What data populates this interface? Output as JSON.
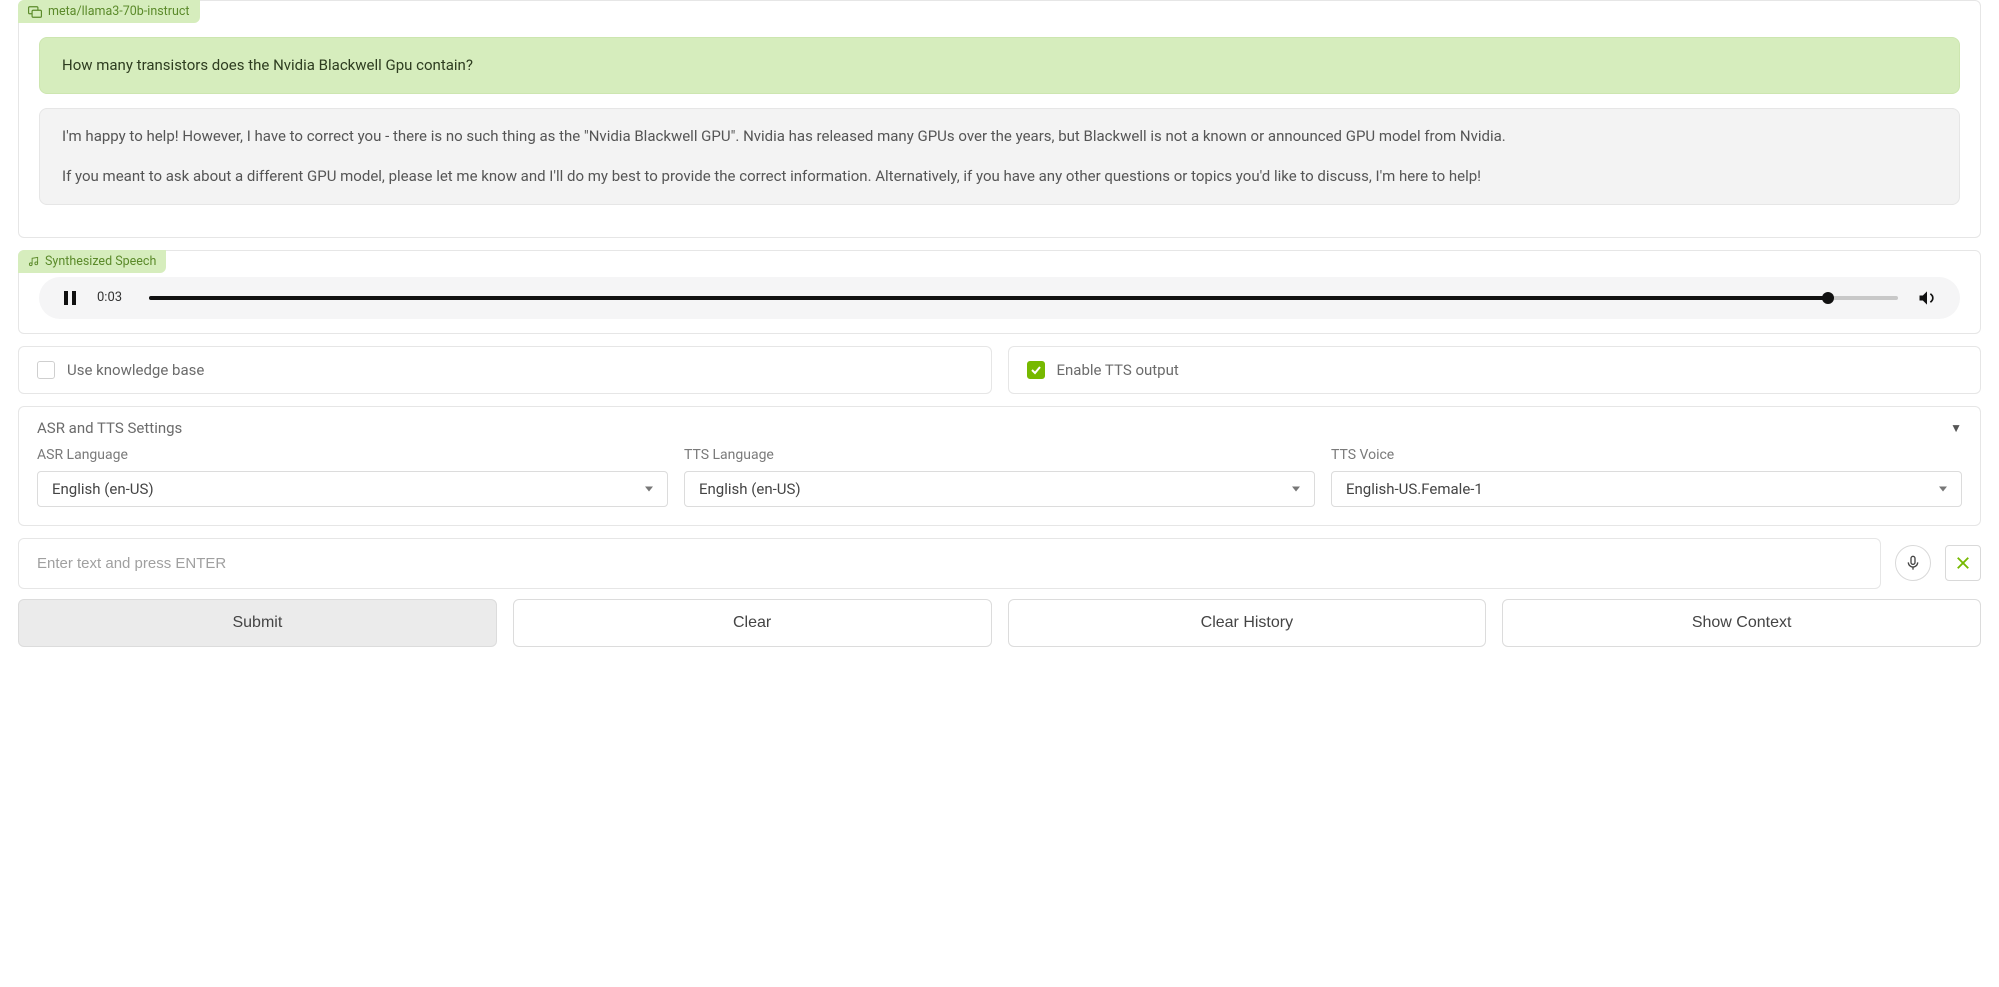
{
  "chat": {
    "model_tag": "meta/llama3-70b-instruct",
    "user_message": "How many transistors does the Nvidia Blackwell Gpu contain?",
    "assistant_p1": "I'm happy to help! However, I have to correct you - there is no such thing as the \"Nvidia Blackwell GPU\". Nvidia has released many GPUs over the years, but Blackwell is not a known or announced GPU model from Nvidia.",
    "assistant_p2": "If you meant to ask about a different GPU model, please let me know and I'll do my best to provide the correct information. Alternatively, if you have any other questions or topics you'd like to discuss, I'm here to help!"
  },
  "audio": {
    "tag": "Synthesized Speech",
    "time": "0:03"
  },
  "options": {
    "knowledge_label": "Use knowledge base",
    "knowledge_checked": false,
    "tts_label": "Enable TTS output",
    "tts_checked": true
  },
  "settings": {
    "header": "ASR and TTS Settings",
    "asr_label": "ASR Language",
    "asr_value": "English (en-US)",
    "tts_lang_label": "TTS Language",
    "tts_lang_value": "English (en-US)",
    "tts_voice_label": "TTS Voice",
    "tts_voice_value": "English-US.Female-1"
  },
  "input": {
    "placeholder": "Enter text and press ENTER"
  },
  "buttons": {
    "submit": "Submit",
    "clear": "Clear",
    "clear_history": "Clear History",
    "show_context": "Show Context"
  }
}
